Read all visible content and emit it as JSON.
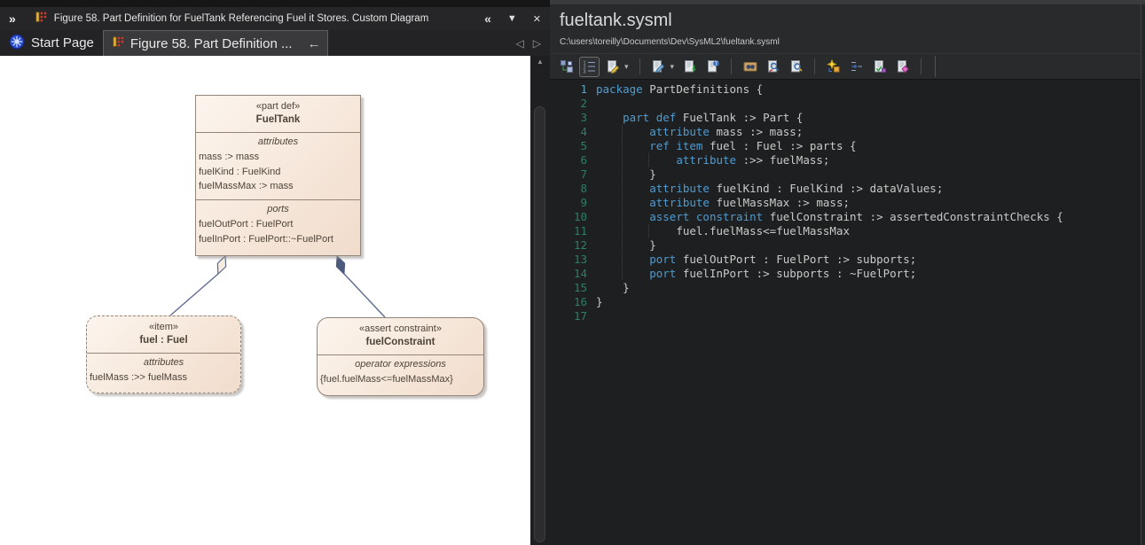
{
  "left_panel": {
    "titlebar": {
      "overflow_chevrons": "»",
      "title": "Figure 58. Part Definition for FuelTank Referencing Fuel it Stores.  Custom Diagram",
      "collapse_glyph": "«",
      "dropdown_glyph": "▼",
      "close_glyph": "✕"
    },
    "tabs": {
      "start_page_label": "Start Page",
      "active_tab_label": "Figure 58. Part Definition ...",
      "back_arrow_glyph": "←",
      "nav_prev_glyph": "◁",
      "nav_next_glyph": "▷"
    },
    "scrollbar_up_glyph": "▲",
    "diagram": {
      "fueltank": {
        "stereotype": "«part def»",
        "name": "FuelTank",
        "attributes_label": "attributes",
        "attributes": [
          "mass :> mass",
          "fuelKind : FuelKind",
          "fuelMassMax :> mass"
        ],
        "ports_label": "ports",
        "ports": [
          "fuelOutPort : FuelPort",
          "fuelInPort : FuelPort::~FuelPort"
        ]
      },
      "fuel": {
        "stereotype": "«item»",
        "name": "fuel : Fuel",
        "attributes_label": "attributes",
        "attributes": [
          "fuelMass :>> fuelMass"
        ]
      },
      "constraint": {
        "stereotype": "«assert constraint»",
        "name": "fuelConstraint",
        "section_label": "operator expressions",
        "expressions": [
          "{fuel.fuelMass<=fuelMassMax}"
        ]
      }
    }
  },
  "right_panel": {
    "title": "fueltank.sysml",
    "path": "C:\\users\\toreilly\\Documents\\Dev\\SysML2\\fueltank.sysml",
    "dropdown_caret_glyph": "▾",
    "toolbar": [
      {
        "name": "model-structure-icon"
      },
      {
        "name": "line-numbers-icon",
        "active": true
      },
      {
        "name": "stereotype-edit-icon",
        "caret": true
      },
      {
        "name": "separator"
      },
      {
        "name": "edit-document-icon",
        "caret": true
      },
      {
        "name": "import-document-icon"
      },
      {
        "name": "text-template-icon"
      },
      {
        "name": "separator"
      },
      {
        "name": "find-in-files-icon"
      },
      {
        "name": "search-replace-icon"
      },
      {
        "name": "search-document-icon"
      },
      {
        "name": "separator"
      },
      {
        "name": "generate-code-icon"
      },
      {
        "name": "indent-format-icon"
      },
      {
        "name": "validate-script-icon"
      },
      {
        "name": "compile-notes-icon"
      },
      {
        "name": "separator"
      },
      {
        "name": "separator-tall"
      }
    ],
    "editor": {
      "keywords": [
        "package",
        "part",
        "def",
        "attribute",
        "ref",
        "item",
        "assert",
        "constraint",
        "port"
      ],
      "lines": [
        "package PartDefinitions {",
        "",
        "    part def FuelTank :> Part {",
        "        attribute mass :> mass;",
        "        ref item fuel : Fuel :> parts {",
        "            attribute :>> fuelMass;",
        "        }",
        "        attribute fuelKind : FuelKind :> dataValues;",
        "        attribute fuelMassMax :> mass;",
        "        assert constraint fuelConstraint :> assertedConstraintChecks {",
        "            fuel.fuelMass<=fuelMassMax",
        "        }",
        "        port fuelOutPort : FuelPort :> subports;",
        "        port fuelInPort :> subports : ~FuelPort;",
        "    }",
        "}",
        ""
      ]
    }
  },
  "colors": {
    "keyword": "#4f9cd2",
    "code_text": "#c9cbca",
    "line_number": "#2f7d6b",
    "line_number_active": "#5fa3bd",
    "editor_bg": "#1d1f20",
    "node_fill_top": "#fcf5ee",
    "node_fill_bottom": "#f1dccc",
    "node_border": "#94857a",
    "node_text": "#4d4438",
    "connector": "#5f6c8e",
    "diamond_filled": "#4c5a7d",
    "diamond_hollow": "#f6ece2"
  }
}
